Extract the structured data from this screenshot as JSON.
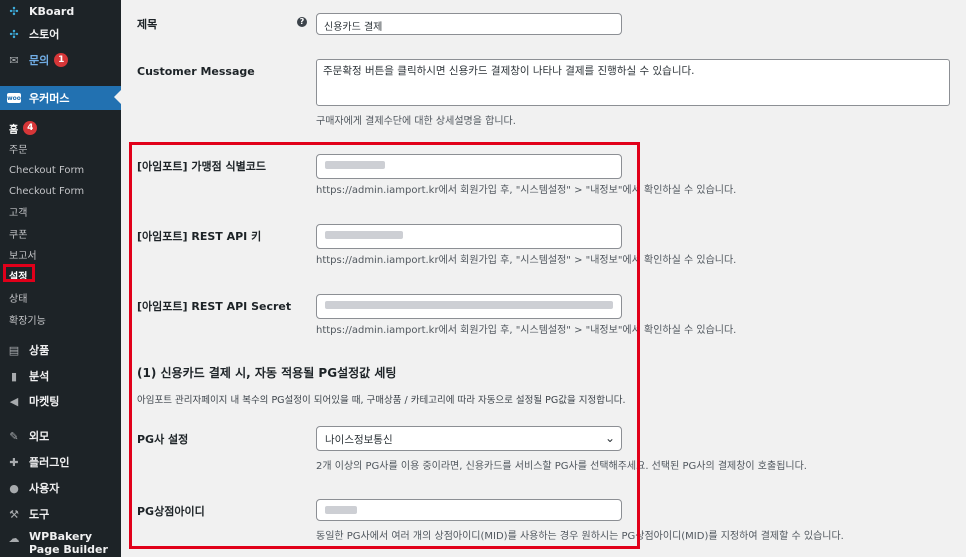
{
  "sidebar": {
    "items": [
      {
        "label": "KBoard",
        "icon": "kboard-icon"
      },
      {
        "label": "스토어",
        "icon": "store-icon"
      },
      {
        "label": "문의",
        "icon": "mail-icon",
        "badge": "1"
      },
      {
        "label": "우커머스",
        "icon": "woocommerce-icon"
      }
    ],
    "sub_items": [
      {
        "label": "홈",
        "badge": "4"
      },
      {
        "label": "주문"
      },
      {
        "label": "Checkout Form"
      },
      {
        "label": "Checkout Form"
      },
      {
        "label": "고객"
      },
      {
        "label": "쿠폰"
      },
      {
        "label": "보고서"
      },
      {
        "label": "설정"
      },
      {
        "label": "상태"
      },
      {
        "label": "확장기능"
      }
    ],
    "lower_items": [
      {
        "label": "상품",
        "icon": "archive-icon"
      },
      {
        "label": "분석",
        "icon": "bar-chart-icon"
      },
      {
        "label": "마켓팅",
        "icon": "megaphone-icon"
      },
      {
        "label": "외모",
        "icon": "paintbrush-icon"
      },
      {
        "label": "플러그인",
        "icon": "plugin-icon"
      },
      {
        "label": "사용자",
        "icon": "user-icon"
      },
      {
        "label": "도구",
        "icon": "wrench-icon"
      },
      {
        "label": "WPBakery Page Builder",
        "icon": "wpbakery-icon"
      }
    ]
  },
  "form": {
    "title": {
      "label": "제목",
      "value": "신용카드 결제"
    },
    "customer_message": {
      "label": "Customer Message",
      "value": "주문확정 버튼을 클릭하시면 신용카드 결제창이 나타나 결제를 진행하실 수 있습니다.",
      "description": "구매자에게 결제수단에 대한 상세설명을 합니다."
    },
    "merchant_code": {
      "label": "[아임포트] 가맹점 식별코드",
      "description": "https://admin.iamport.kr에서 회원가입 후, \"시스템설정\" > \"내정보\"에서 확인하실 수 있습니다."
    },
    "rest_api_key": {
      "label": "[아임포트] REST API 키",
      "description": "https://admin.iamport.kr에서 회원가입 후, \"시스템설정\" > \"내정보\"에서 확인하실 수 있습니다."
    },
    "rest_api_secret": {
      "label": "[아임포트] REST API Secret",
      "description": "https://admin.iamport.kr에서 회원가입 후, \"시스템설정\" > \"내정보\"에서 확인하실 수 있습니다."
    },
    "section": {
      "title": "(1) 신용카드 결제 시, 자동 적용될 PG설정값 세팅",
      "description": "아임포트 관리자페이지 내 복수의 PG설정이 되어있을 때, 구매상품 / 카테고리에 따라 자동으로 설정될 PG값을 지정합니다."
    },
    "pg_setting": {
      "label": "PG사 설정",
      "value": "나이스정보통신",
      "description": "2개 이상의 PG사를 이용 중이라면, 신용카드를 서비스할 PG사를 선택해주세요. 선택된 PG사의 결제창이 호출됩니다."
    },
    "pg_store_id": {
      "label": "PG상점아이디",
      "description": "동일한 PG사에서 여러 개의 상점아이디(MID)를 사용하는 경우 원하시는 PG상점아이디(MID)를 지정하여 결제할 수 있습니다."
    }
  },
  "colors": {
    "sidebar_bg": "#1d2327",
    "active": "#2271b1",
    "highlight": "#e1001a",
    "badge": "#d63638"
  }
}
